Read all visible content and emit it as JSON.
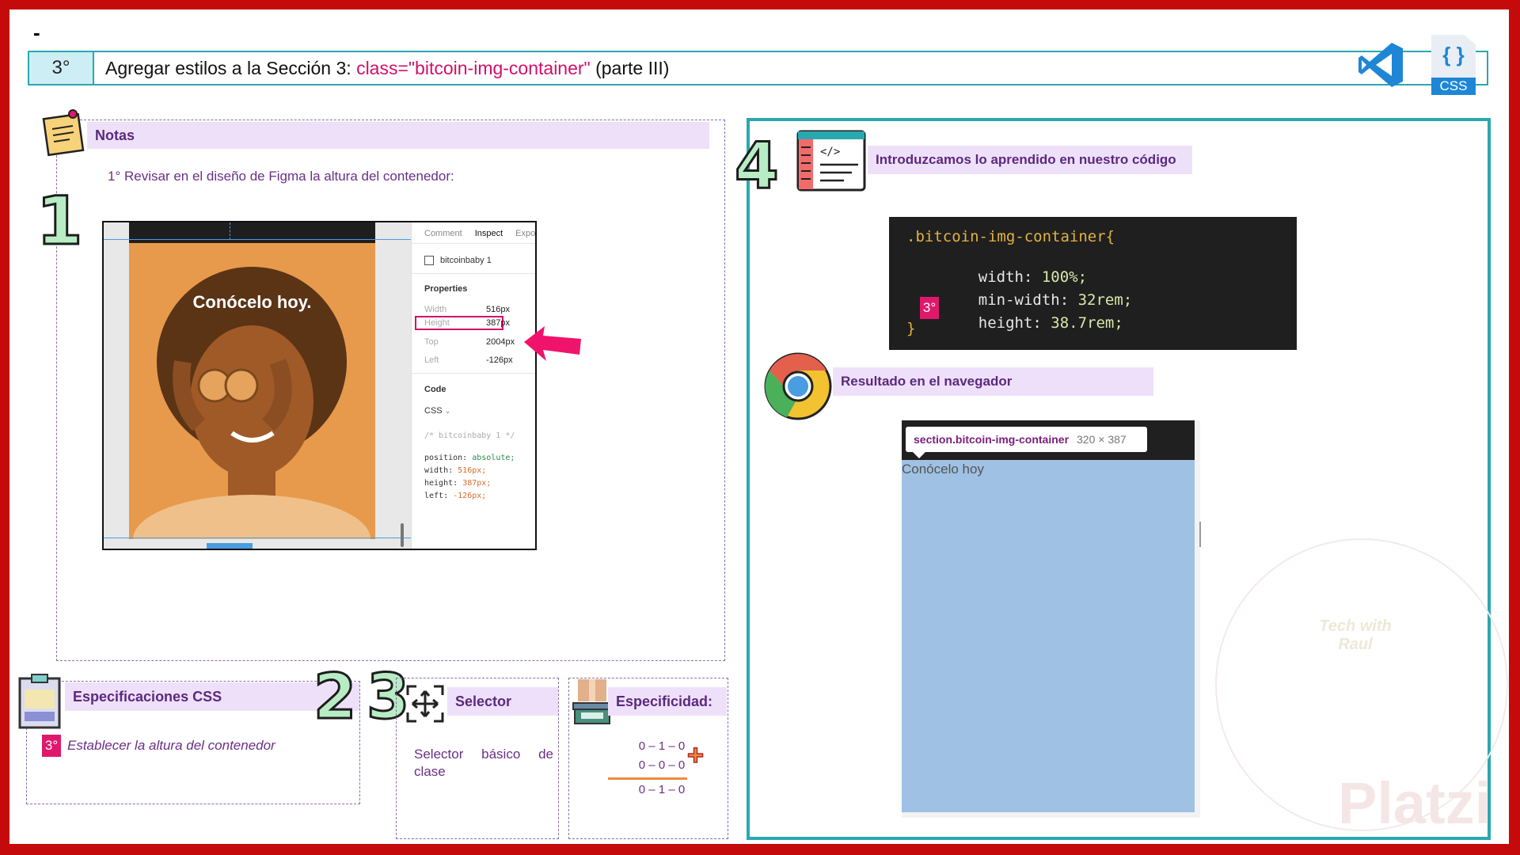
{
  "top_marker": "-",
  "header": {
    "step": "3°",
    "title_prefix": "Agregar estilos a la Sección 3:",
    "title_code": "class=\"bitcoin-img-container\"",
    "title_suffix": "(parte III)",
    "css_badge": "CSS",
    "css_braces": "{ }"
  },
  "notes": {
    "title": "Notas",
    "step_number": "1",
    "instruction": "1° Revisar en el diseño de Figma la altura del contenedor:"
  },
  "figma": {
    "photo_caption": "Conócelo hoy.",
    "tabs": [
      "Comment",
      "Inspect",
      "Expo"
    ],
    "layer_name": "bitcoinbaby 1",
    "properties_title": "Properties",
    "properties": [
      {
        "label": "Width",
        "value": "516px"
      },
      {
        "label": "Height",
        "value": "387px"
      },
      {
        "label": "Top",
        "value": "2004px"
      },
      {
        "label": "Left",
        "value": "-126px"
      }
    ],
    "code_title": "Code",
    "code_lang": "CSS",
    "code_comment": "/* bitcoinbaby 1 */",
    "code_lines": [
      {
        "prop": "position:",
        "val": "absolute;"
      },
      {
        "prop": "width:",
        "val": "516px;"
      },
      {
        "prop": "height:",
        "val": "387px;"
      },
      {
        "prop": "left:",
        "val": "-126px;"
      }
    ]
  },
  "specs": {
    "title": "Especificaciones CSS",
    "badge": "3°",
    "text": "Establecer la altura del contenedor"
  },
  "selector": {
    "step_two": "2",
    "step_three": "3",
    "title": "Selector",
    "text": "Selector básico de clase"
  },
  "specificity": {
    "title": "Especificidad:",
    "row1": "0 – 1 – 0",
    "row2": "0 – 0 – 0",
    "result": "0 – 1 – 0",
    "plus": "+"
  },
  "code_section": {
    "step_number": "4",
    "title": "Introduzcamos lo aprendido en nuestro código",
    "selector": ".bitcoin-img-container{",
    "lines": [
      {
        "prop": "width:",
        "val": "100%;"
      },
      {
        "prop": "min-width:",
        "val": "32rem;"
      },
      {
        "prop": "height:",
        "val": "38.7rem;"
      }
    ],
    "badge": "3°",
    "closing": "}"
  },
  "browser": {
    "title": "Resultado en el navegador",
    "tooltip_selector": "section.bitcoin-img-container",
    "tooltip_size": "320 × 387",
    "content_text": "Conócelo hoy"
  },
  "watermark": {
    "brand": "Platzi",
    "logo_text": "Tech with Raul"
  },
  "colors": {
    "frame": "#c40a0a",
    "accent_teal": "#2aa8b0",
    "accent_pink": "#e0186c",
    "label_bg": "#efe0fa",
    "label_text": "#5a2a7e"
  }
}
